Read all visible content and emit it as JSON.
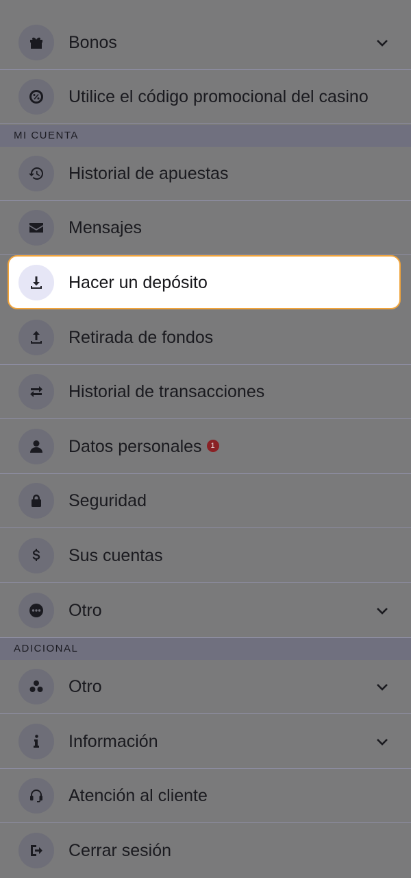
{
  "menu": {
    "bonos": {
      "label": "Bonos",
      "icon": "gift-icon"
    },
    "promo": {
      "label": "Utilice el código promocional del casino",
      "icon": "promo-code-icon"
    },
    "section_account": "MI CUENTA",
    "bet_history": {
      "label": "Historial de apuestas",
      "icon": "history-icon"
    },
    "messages": {
      "label": "Mensajes",
      "icon": "envelope-icon"
    },
    "deposit": {
      "label": "Hacer un depósito",
      "icon": "download-icon"
    },
    "withdraw": {
      "label": "Retirada de fondos",
      "icon": "upload-icon"
    },
    "transactions": {
      "label": "Historial de transacciones",
      "icon": "transfer-icon"
    },
    "personal": {
      "label": "Datos personales",
      "icon": "user-icon",
      "badge": "1"
    },
    "security": {
      "label": "Seguridad",
      "icon": "lock-icon"
    },
    "accounts": {
      "label": "Sus cuentas",
      "icon": "dollar-icon"
    },
    "other_account": {
      "label": "Otro",
      "icon": "more-icon"
    },
    "section_additional": "ADICIONAL",
    "other_additional": {
      "label": "Otro",
      "icon": "circles-icon"
    },
    "info": {
      "label": "Información",
      "icon": "info-icon"
    },
    "support": {
      "label": "Atención al cliente",
      "icon": "headset-icon"
    },
    "logout": {
      "label": "Cerrar sesión",
      "icon": "logout-icon"
    }
  },
  "colors": {
    "highlight_border": "#f0a33a",
    "badge": "#8a2125",
    "section_bg": "#70707f"
  }
}
